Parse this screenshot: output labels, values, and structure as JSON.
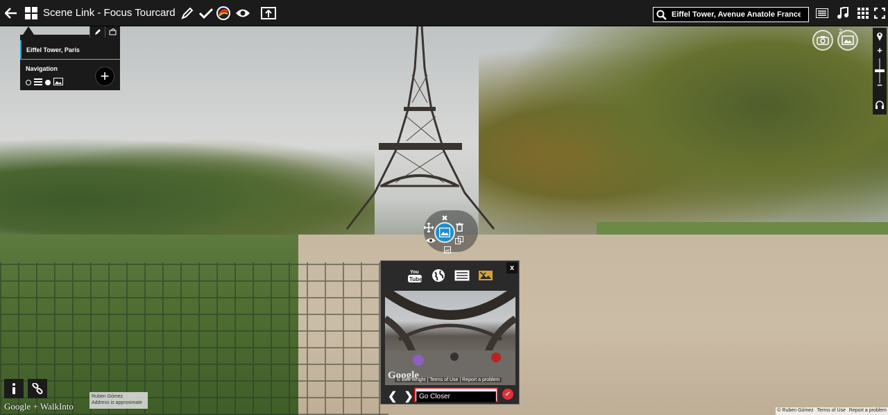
{
  "topbar": {
    "title": "Scene Link - Focus Tourcard",
    "search_value": "Eiffel Tower, Avenue Anatole France, l",
    "icons": [
      "back-arrow-icon",
      "grid-icon",
      "pencil-icon",
      "checkmark-icon",
      "color-palette-icon",
      "eye-icon",
      "publish-icon",
      "search-icon",
      "list-icon",
      "music-icon",
      "apps-grid-icon",
      "fullscreen-icon"
    ]
  },
  "scene_panel": {
    "scene_name": "Eiffel Tower, Paris",
    "navigation_label": "Navigation",
    "add_label": "+"
  },
  "map_controls": {
    "zoom_in": "+",
    "zoom_out": "−",
    "photo_badge": "2"
  },
  "popup": {
    "close_label": "x",
    "tabs": [
      "youtube-icon",
      "globe-icon",
      "text-icon",
      "image-icon"
    ],
    "active_tab": "image",
    "youtube_text": "You Tube",
    "preview_brand": "Google",
    "preview_terms": [
      "© Ben Wright",
      "Terms of Use",
      "Report a problem"
    ],
    "title_value": "Go Closer",
    "accent_color": "#e10b1b"
  },
  "bottom": {
    "brand": "Google + WalkInto",
    "author_name": "Ruben Gómez",
    "author_note": "Address is approximate",
    "attribution": [
      "© Ruben Gómez",
      "Terms of Use",
      "Report a problem"
    ]
  }
}
